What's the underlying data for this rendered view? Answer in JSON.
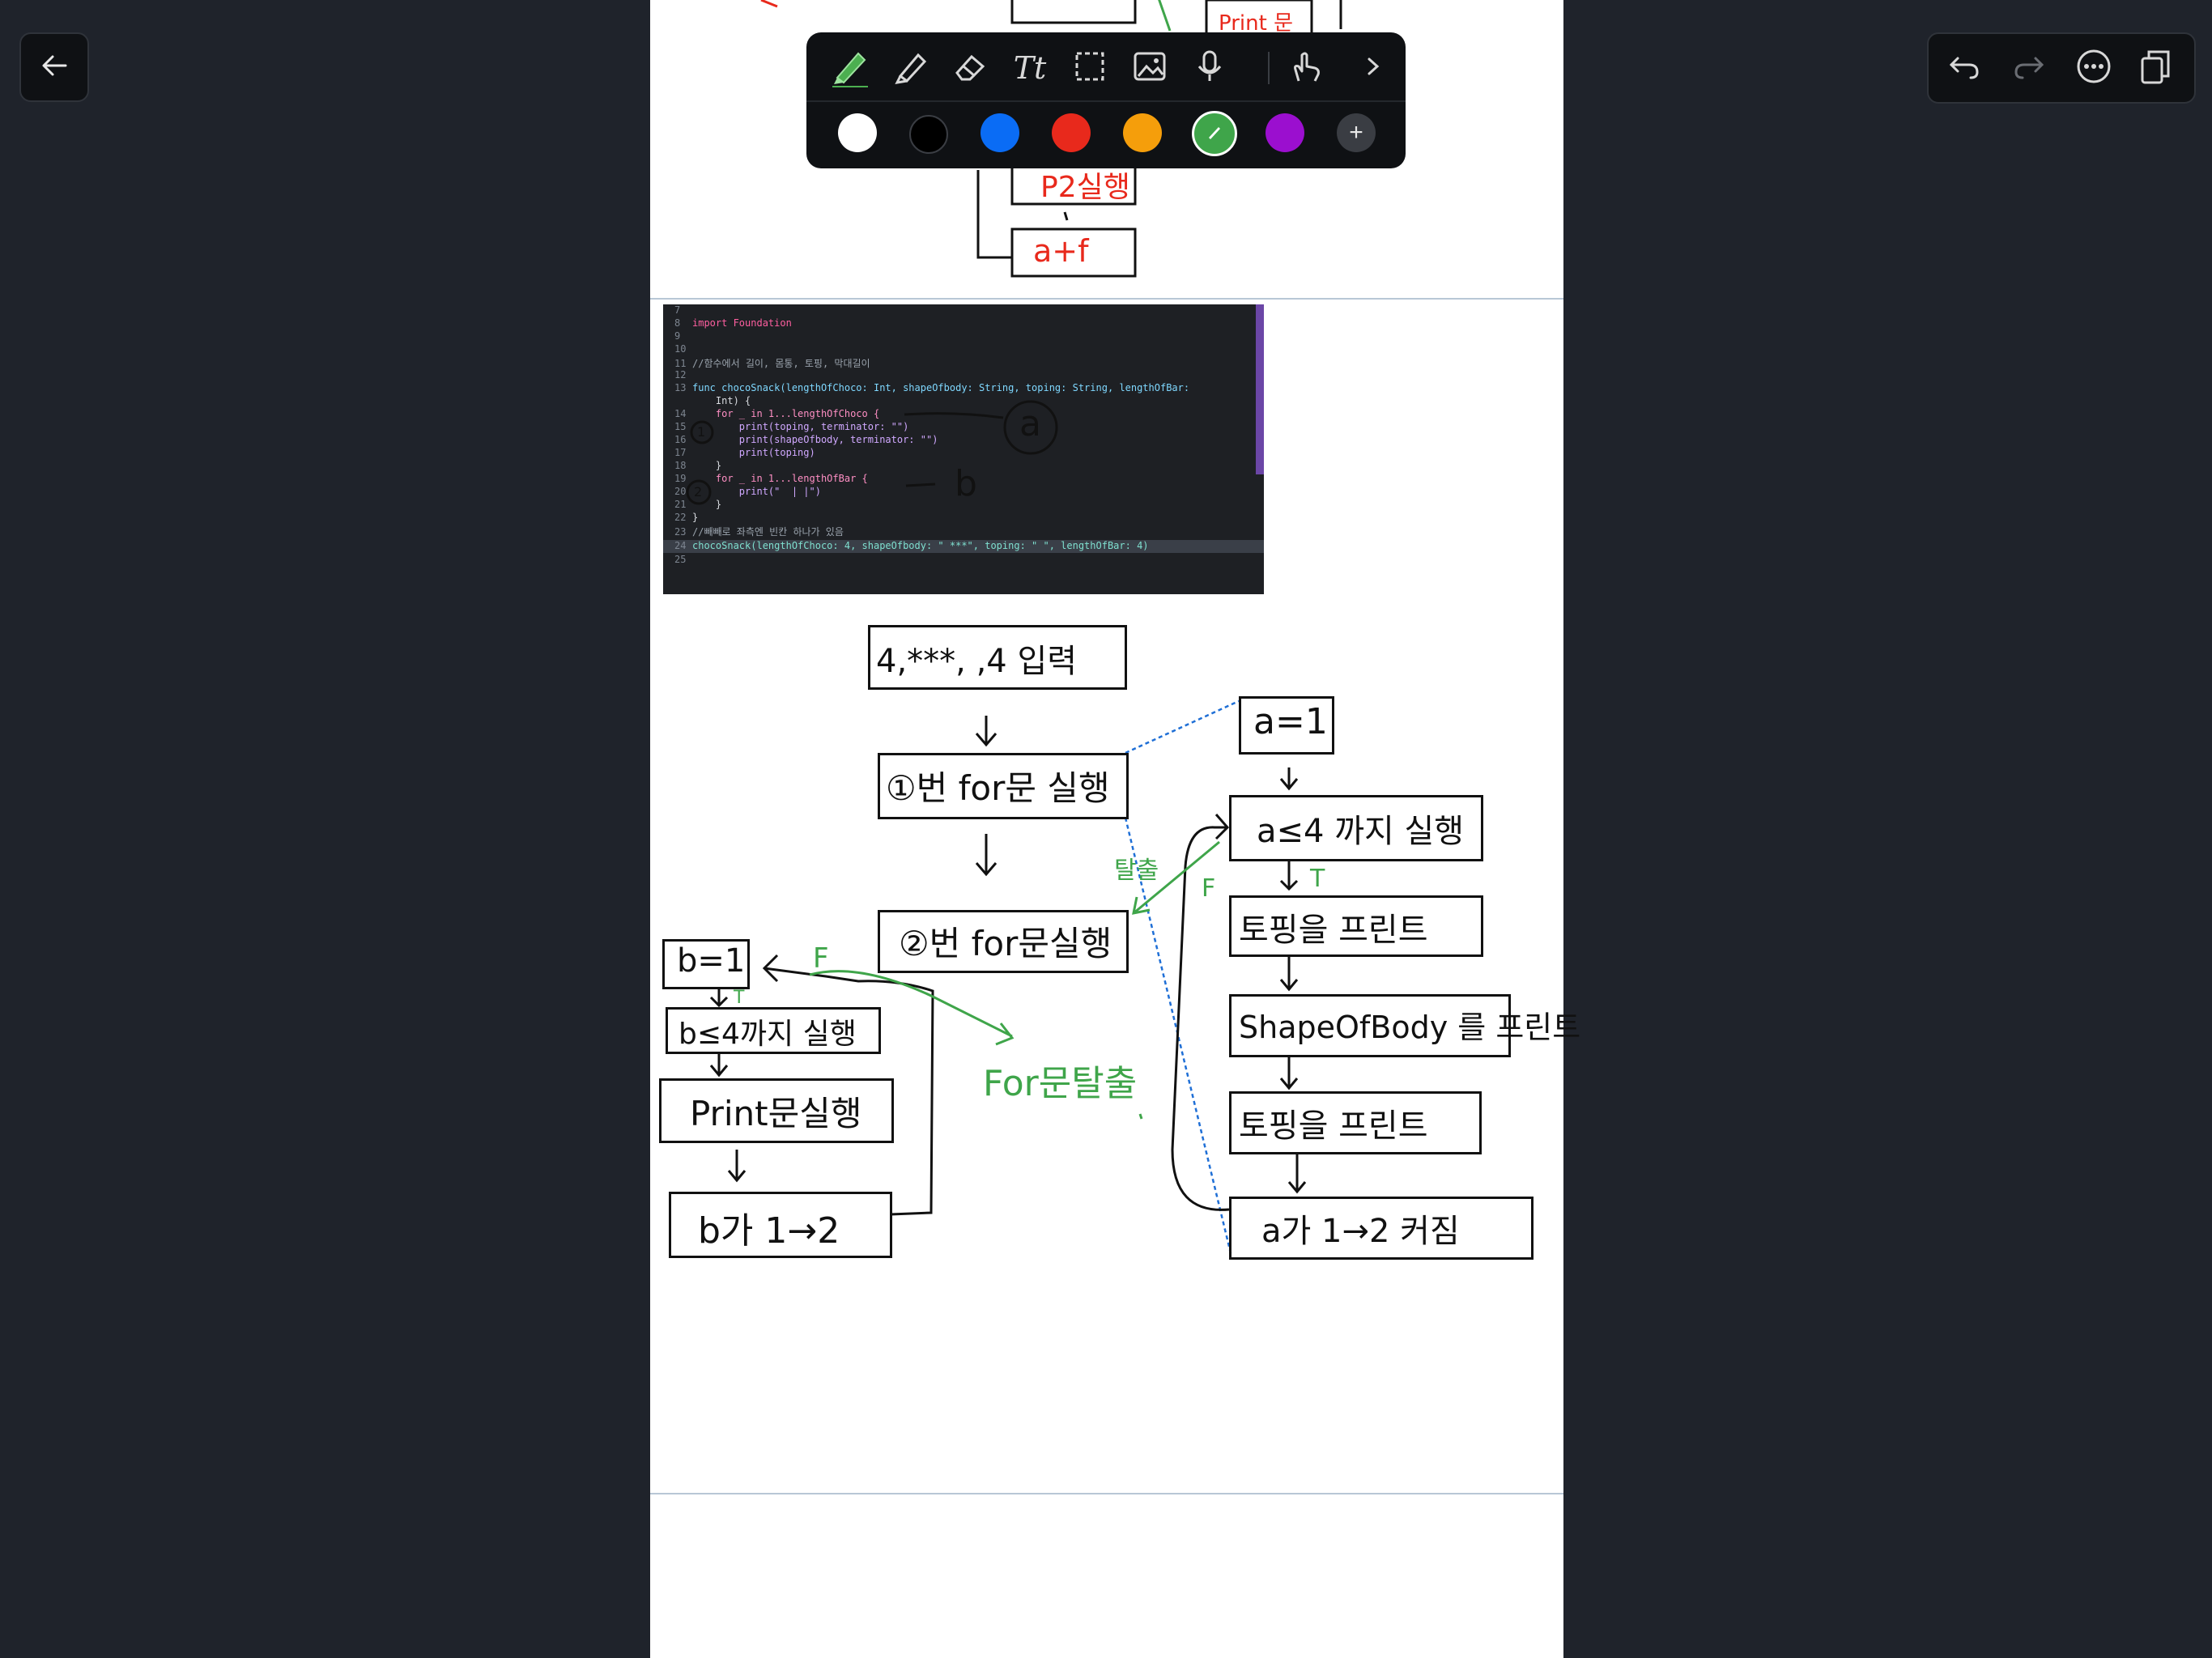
{
  "top_left": {
    "back_label": "Back"
  },
  "toolbar": {
    "tools": [
      "pen",
      "marker",
      "eraser",
      "text",
      "lasso-select",
      "image",
      "microphone",
      "touch"
    ],
    "colors": [
      "#ffffff",
      "#000000",
      "#0a6cf5",
      "#e8291c",
      "#f59e0b",
      "#3fa54a",
      "#9b0fcf"
    ],
    "selected_color": "#3fa54a",
    "add_color_label": "+"
  },
  "top_right": {
    "undo": "undo-icon",
    "redo": "redo-icon",
    "more": "more-icon",
    "pages": "pages-icon"
  },
  "upper_fragment": {
    "print_label": "Print 문",
    "p2_label": "P2실행",
    "aplus_label": "a+f"
  },
  "code": {
    "lines": [
      {
        "n": "7",
        "t": ""
      },
      {
        "n": "8",
        "t": "import Foundation"
      },
      {
        "n": "9",
        "t": ""
      },
      {
        "n": "10",
        "t": ""
      },
      {
        "n": "11",
        "t": "//함수에서 길이, 몸통, 토핑, 막대길이"
      },
      {
        "n": "12",
        "t": ""
      },
      {
        "n": "13",
        "t": "func chocoSnack(lengthOfChoco: Int, shapeOfbody: String, toping: String, lengthOfBar:"
      },
      {
        "n": "",
        "t": "    Int) {"
      },
      {
        "n": "14",
        "t": "    for _ in 1...lengthOfChoco {"
      },
      {
        "n": "15",
        "t": "        print(toping, terminator: \"\")"
      },
      {
        "n": "16",
        "t": "        print(shapeOfbody, terminator: \"\")"
      },
      {
        "n": "17",
        "t": "        print(toping)"
      },
      {
        "n": "18",
        "t": "    }"
      },
      {
        "n": "19",
        "t": "    for _ in 1...lengthOfBar {"
      },
      {
        "n": "20",
        "t": "        print(\"  | |\")"
      },
      {
        "n": "21",
        "t": "    }"
      },
      {
        "n": "22",
        "t": "}"
      },
      {
        "n": "23",
        "t": "//빼빼로 좌측엔 빈칸 하나가 있음"
      },
      {
        "n": "24",
        "t": "chocoSnack(lengthOfChoco: 4, shapeOfbody: \" ***\", toping: \" \", lengthOfBar: 4)"
      },
      {
        "n": "25",
        "t": ""
      }
    ],
    "annot_a": "a",
    "annot_b": "b",
    "annot_1": "1",
    "annot_2": "2"
  },
  "flow": {
    "input": "4,***, ,4 입력",
    "step1": "①번 for문 실행",
    "step2": "②번 for문실행",
    "a_init": "a=1",
    "a_cond": "a≤4 까지 실행",
    "toping1": "토핑을 프린트",
    "shape": "ShapeOfBody 를 프린트",
    "toping2": "토핑을 프린트",
    "a_inc": "a가 1→2 커짐",
    "b_init": "b=1",
    "b_cond": "b≤4까지 실행",
    "b_print": "Print문실행",
    "b_inc": "b가 1→2",
    "exit1": "탈출",
    "f1": "F",
    "t1": "T",
    "f2": "F",
    "t2": "T",
    "exit2": "For문탈출"
  }
}
